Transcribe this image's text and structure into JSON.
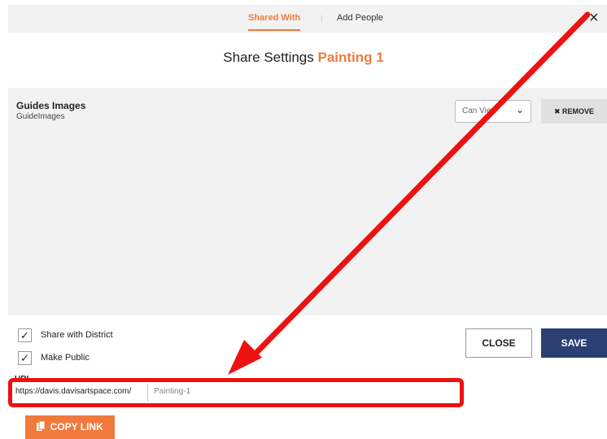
{
  "tabs": {
    "shared_with": "Shared With",
    "separator": "|",
    "add_people": "Add People"
  },
  "close_icon": "×",
  "header": {
    "title": "Share Settings",
    "artwork_name": "Painting 1"
  },
  "shared_item": {
    "name": "Guides Images",
    "subtitle": "GuideImages",
    "permission": "Can View",
    "remove_label": "✖ REMOVE"
  },
  "options": {
    "share_with_district": {
      "label": "Share with District",
      "checked": true
    },
    "make_public": {
      "label": "Make Public",
      "checked": true
    }
  },
  "checkmark": "✓",
  "url": {
    "label": "URL",
    "prefix": "https://davis.davisartspace.com/",
    "value": "Painting-1"
  },
  "buttons": {
    "close": "CLOSE",
    "save": "SAVE",
    "copy_link": "COPY LINK"
  },
  "icons": {
    "copy": "copy-icon",
    "chevron": "chevron-down-icon",
    "close": "close-icon"
  },
  "colors": {
    "accent": "#f07a3c",
    "save": "#2b3f73",
    "annotation": "#ee1111"
  }
}
